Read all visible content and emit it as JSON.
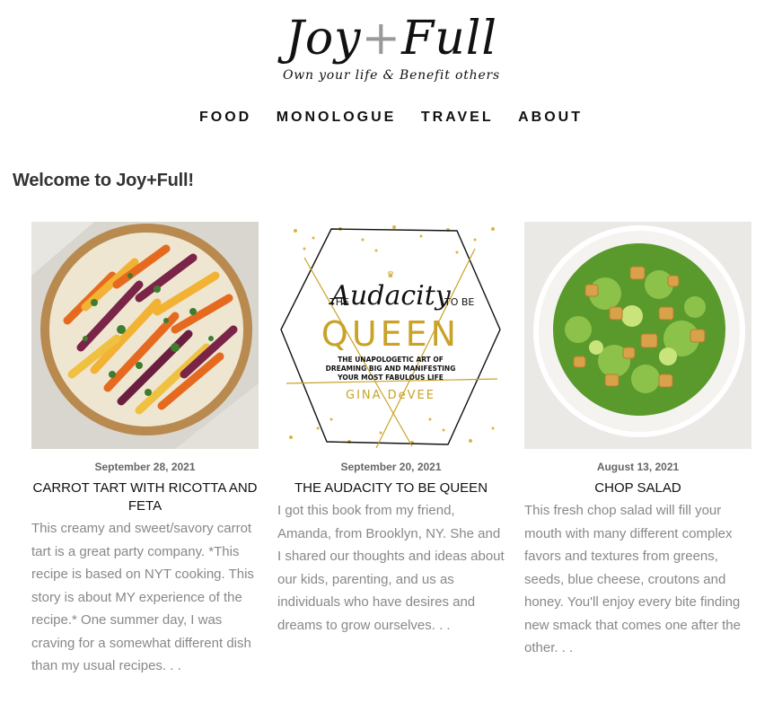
{
  "site": {
    "logo_part1": "Joy",
    "logo_plus": "+",
    "logo_part2": "Full",
    "tagline": "Own your life & Benefit others"
  },
  "nav": {
    "items": [
      {
        "label": "FOOD"
      },
      {
        "label": "MONOLOGUE"
      },
      {
        "label": "TRAVEL"
      },
      {
        "label": "ABOUT"
      }
    ]
  },
  "main": {
    "heading": "Welcome to Joy+Full!",
    "posts": [
      {
        "date": "September 28, 2021",
        "title": "CARROT TART WITH RICOTTA AND FETA",
        "excerpt": "This creamy and sweet/savory carrot tart is a great party company. *This recipe is based on NYT cooking. This story is about MY experience of the recipe.* One summer day, I was craving for a somewhat different dish than my usual recipes. . ."
      },
      {
        "date": "September 20, 2021",
        "title": "THE AUDACITY TO BE QUEEN",
        "excerpt": "I got this book from my friend, Amanda, from Brooklyn, NY. She and I shared our thoughts and ideas about our kids, parenting, and us as individuals who have desires and dreams to grow ourselves. . .",
        "cover": {
          "line1": "THE",
          "script": "Audacity",
          "line2": "TO BE",
          "big": "QUEEN",
          "sub1": "THE UNAPOLOGETIC ART OF",
          "sub2": "DREAMING BIG AND MANIFESTING",
          "sub3": "YOUR MOST FABULOUS LIFE",
          "author": "GINA DeVEE"
        }
      },
      {
        "date": "August 13, 2021",
        "title": "CHOP SALAD",
        "excerpt": "This fresh chop salad will fill your mouth with many different complex favors and textures from greens, seeds, blue cheese, croutons and honey. You'll enjoy every bite finding new smack that comes one after the other. . ."
      }
    ]
  },
  "colors": {
    "gold": "#c9a227",
    "text": "#111111",
    "muted": "#888888"
  }
}
